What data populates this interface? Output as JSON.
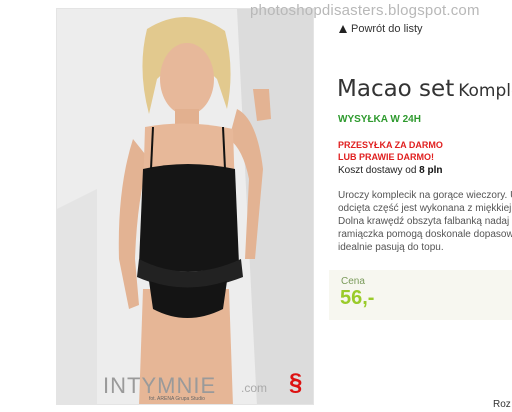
{
  "watermark": "photoshopdisasters.blogspot.com",
  "back_link": "Powrót do listy",
  "product": {
    "name": "Macao set",
    "subtitle": "Komplet",
    "shipping_badge": "WYSYŁKA W 24H",
    "promo_line1": "PRZESYŁKA ZA DARMO",
    "promo_line2": "LUB PRAWIE DARMO!",
    "cost_label": "Koszt dostawy od",
    "cost_value": "8 pln",
    "description": [
      "Uroczy komplecik na gorące wieczory. U",
      "odcięta część jest wykonana z miękkiej",
      "Dolna krawędź obszyta falbanką nadaj",
      "ramiączka pomogą doskonale dopasow",
      "idealnie pasują do topu."
    ],
    "price_label": "Cena",
    "price": "56,-"
  },
  "photo": {
    "brand_logo_text": "INTYMNIE",
    "brand_logo_suffix": ".com",
    "photo_credit": "fot. ARENA Grupa Studio"
  },
  "footer_partial": "Roz",
  "colors": {
    "green": "#2e9a2e",
    "red": "#e02020",
    "price": "#9acb2a"
  }
}
